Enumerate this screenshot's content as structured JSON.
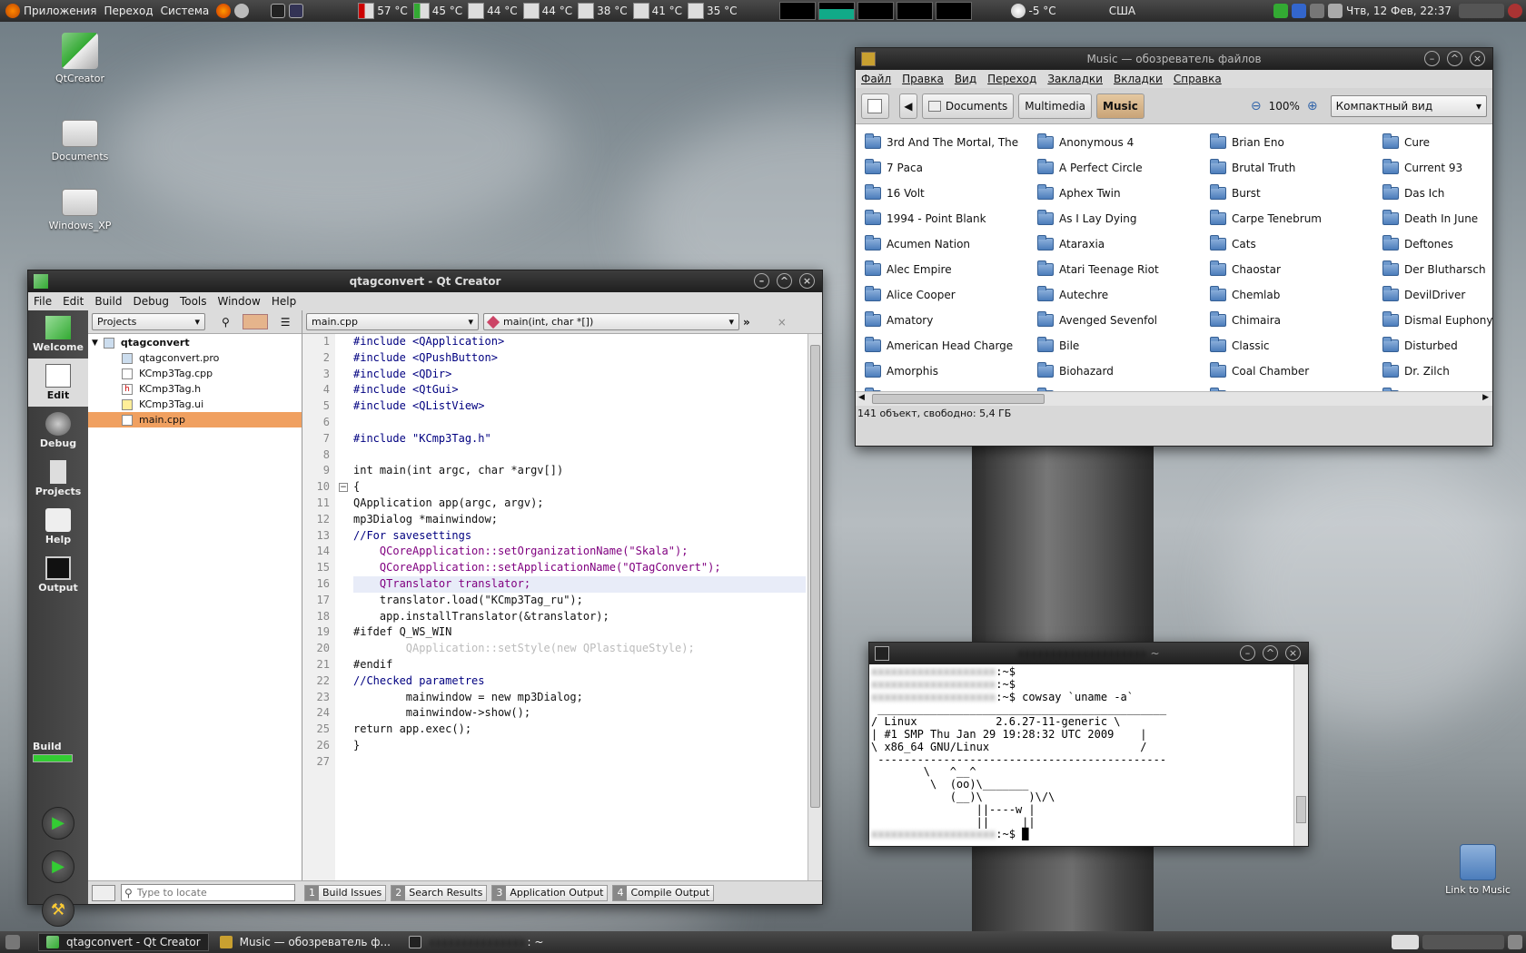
{
  "top_panel": {
    "menus": [
      "Приложения",
      "Переход",
      "Система"
    ],
    "sensors": [
      "57 °C",
      "45 °C",
      "44 °C",
      "44 °C",
      "38 °C",
      "41 °C",
      "35 °C"
    ],
    "weather": "-5 °C",
    "locale": "США",
    "clock": "Чтв, 12 Фев, 22:37"
  },
  "desktop": {
    "icons": [
      {
        "label": "QtCreator"
      },
      {
        "label": "Documents"
      },
      {
        "label": "Windows_XP"
      },
      {
        "label": "Link to Music"
      }
    ]
  },
  "qtcreator": {
    "title": "qtagconvert - Qt Creator",
    "menu": [
      "File",
      "Edit",
      "Build",
      "Debug",
      "Tools",
      "Window",
      "Help"
    ],
    "modes": [
      "Welcome",
      "Edit",
      "Debug",
      "Projects",
      "Help",
      "Output"
    ],
    "build_label": "Build",
    "projects_combo": "Projects",
    "project_name": "qtagconvert",
    "files": [
      "qtagconvert.pro",
      "KCmp3Tag.cpp",
      "KCmp3Tag.h",
      "KCmp3Tag.ui",
      "main.cpp"
    ],
    "open_file": "main.cpp",
    "function_combo": "main(int, char *[])",
    "locate_placeholder": "Type to locate",
    "output_tabs": [
      {
        "num": "1",
        "label": "Build Issues"
      },
      {
        "num": "2",
        "label": "Search Results"
      },
      {
        "num": "3",
        "label": "Application Output"
      },
      {
        "num": "4",
        "label": "Compile Output"
      }
    ],
    "line_numbers": [
      "1",
      "2",
      "3",
      "4",
      "5",
      "6",
      "7",
      "8",
      "9",
      "10",
      "11",
      "12",
      "13",
      "14",
      "15",
      "16",
      "17",
      "18",
      "19",
      "20",
      "21",
      "22",
      "23",
      "24",
      "25",
      "26",
      "27"
    ],
    "code_lines": [
      "#include <QApplication>",
      "#include <QPushButton>",
      "#include <QDir>",
      "#include <QtGui>",
      "#include <QListView>",
      "",
      "#include \"KCmp3Tag.h\"",
      "",
      "int main(int argc, char *argv[])",
      "{",
      "QApplication app(argc, argv);",
      "mp3Dialog *mainwindow;",
      "//For savesettings",
      "    QCoreApplication::setOrganizationName(\"Skala\");",
      "    QCoreApplication::setApplicationName(\"QTagConvert\");",
      "    QTranslator translator;",
      "    translator.load(\"KCmp3Tag_ru\");",
      "    app.installTranslator(&translator);",
      "#ifdef Q_WS_WIN",
      "        QApplication::setStyle(new QPlastiqueStyle);",
      "#endif",
      "//Checked parametres",
      "        mainwindow = new mp3Dialog;",
      "        mainwindow->show();",
      "return app.exec();",
      "}",
      ""
    ]
  },
  "file_browser": {
    "title": "Music — обозреватель файлов",
    "menu": [
      "Файл",
      "Правка",
      "Вид",
      "Переход",
      "Закладки",
      "Вкладки",
      "Справка"
    ],
    "path": [
      "Documents",
      "Multimedia",
      "Music"
    ],
    "zoom": "100%",
    "view_mode": "Компактный вид",
    "status": "141 объект, свободно: 5,4 ГБ",
    "columns": [
      [
        "3rd And The Mortal, The",
        "7 Раса",
        "16 Volt",
        "1994 - Point Blank",
        "Acumen Nation",
        "Alec Empire",
        "Alice Cooper",
        "Amatory",
        "American Head Charge",
        "Amorphis",
        "Angelspit"
      ],
      [
        "Anonymous 4",
        "A Perfect Circle",
        "Aphex Twin",
        "As I Lay Dying",
        "Ataraxia",
        "Atari Teenage Riot",
        "Autechre",
        "Avenged Sevenfol",
        "Bile",
        "Biohazard",
        "Bjork"
      ],
      [
        "Brian Eno",
        "Brutal Truth",
        "Burst",
        "Carpe Tenebrum",
        "Cats",
        "Chaostar",
        "Chemlab",
        "Chimaira",
        "Classic",
        "Coal Chamber",
        "Cold"
      ],
      [
        "Cure",
        "Current 93",
        "Das Ich",
        "Death In June",
        "Deftones",
        "Der Blutharsch",
        "DevilDriver",
        "Dismal Euphony",
        "Disturbed",
        "Dr. Zilch",
        "Evanescence"
      ]
    ]
  },
  "terminal": {
    "title": "~",
    "lines": [
      ":~$",
      ":~$",
      ":~$ cowsay `uname -a`",
      " ____________________________________________",
      "/ Linux            2.6.27-11-generic \\",
      "| #1 SMP Thu Jan 29 19:28:32 UTC 2009    |",
      "\\ x86_64 GNU/Linux                       /",
      " --------------------------------------------",
      "        \\   ^__^",
      "         \\  (oo)\\_______",
      "            (__)\\       )\\/\\",
      "                ||----w |",
      "                ||     ||",
      ":~$ █"
    ]
  },
  "taskbar": {
    "tasks": [
      "qtagconvert - Qt Creator",
      "Music — обозреватель ф...",
      ": ~"
    ]
  },
  "colors": {
    "selection": "#f0a060",
    "panel": "#2b2b2b",
    "active_path": "#c9a478"
  }
}
